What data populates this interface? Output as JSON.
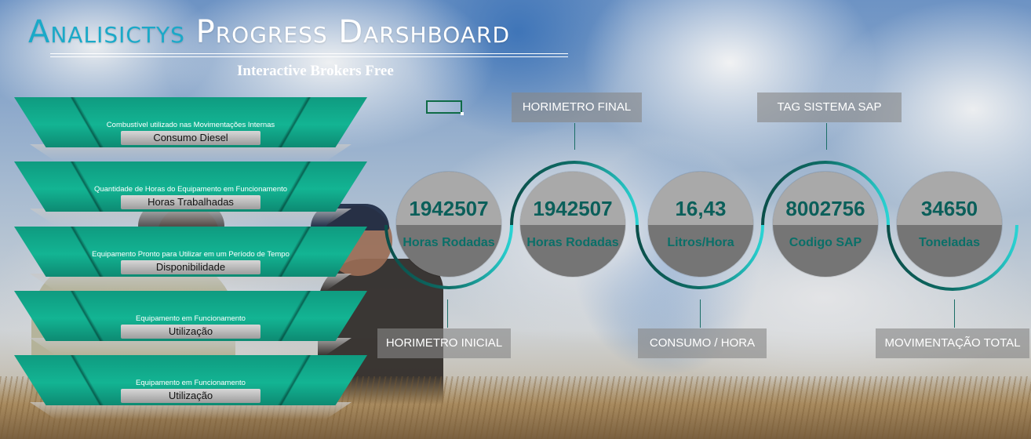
{
  "header": {
    "title_part1": "Analisictys",
    "title_part2": "Progress Darshboard",
    "subtitle": "Interactive Brokers Free"
  },
  "left_cards": [
    {
      "description": "Combustível utilizado nas Movimentações Internas",
      "label": "Consumo Diesel"
    },
    {
      "description": "Quantidade de Horas do Equipamento em Funcionamento",
      "label": "Horas Trabalhadas"
    },
    {
      "description": "Equipamento Pronto para Utilizar em um Período de Tempo",
      "label": "Disponibilidade"
    },
    {
      "description": "Equipamento em Funcionamento",
      "label": "Utilização"
    },
    {
      "description": "Equipamento em Funcionamento",
      "label": "Utilização"
    }
  ],
  "kpis": [
    {
      "value": "1942507",
      "unit": "Horas Rodadas",
      "callout": "HORIMETRO INICIAL"
    },
    {
      "value": "1942507",
      "unit": "Horas Rodadas",
      "callout": "HORIMETRO FINAL"
    },
    {
      "value": "16,43",
      "unit": "Litros/Hora",
      "callout": "CONSUMO / HORA"
    },
    {
      "value": "8002756",
      "unit": "Codigo SAP",
      "callout": "TAG SISTEMA SAP"
    },
    {
      "value": "34650",
      "unit": "Toneladas",
      "callout": "MOVIMENTAÇÃO TOTAL"
    }
  ],
  "colors": {
    "title_accent": "#1aa9c8",
    "card_green": "#13b493",
    "kpi_value": "#0b5f5a",
    "arc_dark": "#0b4f4a",
    "arc_light": "#2ad3d3"
  }
}
